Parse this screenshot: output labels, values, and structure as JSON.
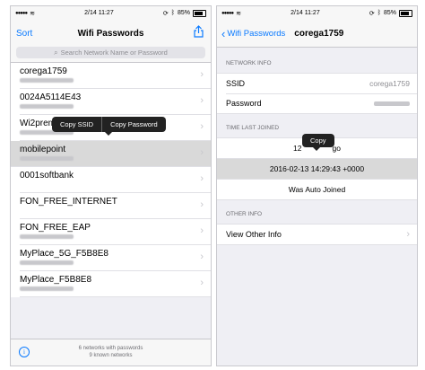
{
  "left": {
    "status": {
      "carrier": "●●●●●",
      "time": "2/14 11:27",
      "battery": "85%"
    },
    "nav": {
      "left": "Sort",
      "title": "Wifi Passwords",
      "share_icon": "share-icon"
    },
    "search": {
      "placeholder": "Search Network Name or Password"
    },
    "networks": [
      {
        "name": "corega1759"
      },
      {
        "name": "0024A5114E43"
      },
      {
        "name": "Wi2prem"
      },
      {
        "name": "mobilepoint"
      },
      {
        "name": "0001softbank"
      },
      {
        "name": "FON_FREE_INTERNET"
      },
      {
        "name": "FON_FREE_EAP"
      },
      {
        "name": "MyPlace_5G_F5B8E8"
      },
      {
        "name": "MyPlace_F5B8E8"
      }
    ],
    "popup": {
      "copy_ssid": "Copy SSID",
      "copy_password": "Copy Password"
    },
    "footer": {
      "line1": "6 networks with passwords",
      "line2": "9 known networks",
      "info_icon": "i"
    }
  },
  "right": {
    "status": {
      "carrier": "●●●●●",
      "time": "2/14 11:27",
      "battery": "85%"
    },
    "nav": {
      "back": "Wifi Passwords",
      "title": "corega1759"
    },
    "network_info": {
      "header": "NETWORK INFO",
      "ssid_label": "SSID",
      "ssid_value": "corega1759",
      "password_label": "Password"
    },
    "time_last_joined": {
      "header": "TIME LAST JOINED",
      "relative": "12",
      "relative_suffix": "go",
      "timestamp": "2016-02-13 14:29:43 +0000",
      "auto": "Was Auto Joined"
    },
    "copy_popup": "Copy",
    "other_info": {
      "header": "OTHER INFO",
      "view": "View Other Info"
    }
  }
}
